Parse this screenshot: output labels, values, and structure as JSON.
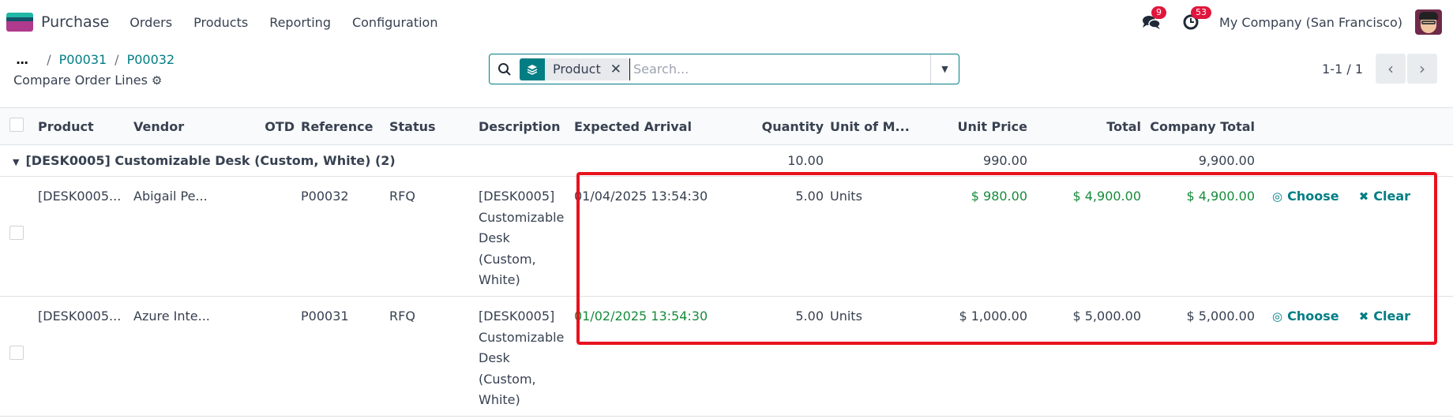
{
  "navbar": {
    "app_name": "Purchase",
    "menu": [
      "Orders",
      "Products",
      "Reporting",
      "Configuration"
    ],
    "messages_badge": "9",
    "activities_badge": "53",
    "company": "My Company (San Francisco)"
  },
  "breadcrumb": {
    "dots": "...",
    "items": [
      "P00031",
      "P00032"
    ],
    "separator": "/"
  },
  "view_title": "Compare Order Lines",
  "search": {
    "facet_label": "Product",
    "facet_remove": "✕",
    "placeholder": "Search..."
  },
  "pager": {
    "value": "1-1 / 1",
    "prev": "‹",
    "next": "›"
  },
  "table": {
    "columns": [
      "Product",
      "Vendor",
      "OTD",
      "Reference",
      "Status",
      "Description",
      "Expected Arrival",
      "Quantity",
      "Unit of M...",
      "Unit Price",
      "Total",
      "Company Total"
    ],
    "group": {
      "label": "[DESK0005] Customizable Desk (Custom, White) (2)",
      "quantity": "10.00",
      "unit_price": "990.00",
      "company_total": "9,900.00"
    },
    "rows": [
      {
        "product": "[DESK0005...",
        "vendor": "Abigail Pe...",
        "otd": "",
        "reference": "P00032",
        "status": "RFQ",
        "description": "[DESK0005] Customizable Desk (Custom, White)",
        "expected_arrival": "01/04/2025 13:54:30",
        "quantity": "5.00",
        "uom": "Units",
        "unit_price": "$ 980.00",
        "total": "$ 4,900.00",
        "company_total": "$ 4,900.00",
        "choose": "Choose",
        "clear": "Clear"
      },
      {
        "product": "[DESK0005...",
        "vendor": "Azure Inte...",
        "otd": "",
        "reference": "P00031",
        "status": "RFQ",
        "description": "[DESK0005] Customizable Desk (Custom, White)",
        "expected_arrival": "01/02/2025 13:54:30",
        "quantity": "5.00",
        "uom": "Units",
        "unit_price": "$ 1,000.00",
        "total": "$ 5,000.00",
        "company_total": "$ 5,000.00",
        "choose": "Choose",
        "clear": "Clear"
      }
    ]
  },
  "colors": {
    "brand": "#017e84",
    "best_value": "#178b3b",
    "highlight": "#e8121f",
    "badge": "#e0163c"
  }
}
